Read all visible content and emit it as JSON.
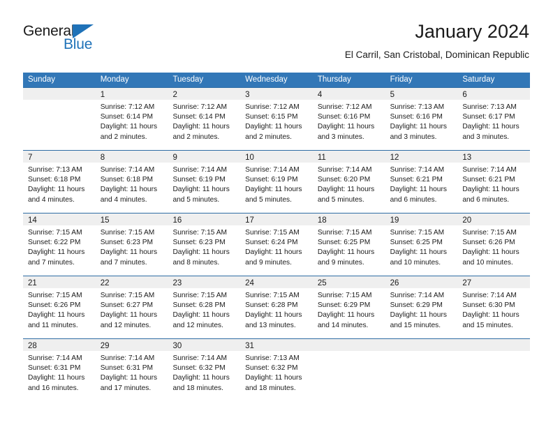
{
  "logo": {
    "word_top": "General",
    "word_bottom": "Blue",
    "triangle_icon": "triangle-icon",
    "color_blue": "#1f72b8",
    "color_black": "#1a1a1a"
  },
  "header": {
    "title": "January 2024",
    "subtitle": "El Carril, San Cristobal, Dominican Republic"
  },
  "theme": {
    "header_blue": "#3277b7",
    "row_border_blue": "#2e6da4",
    "daynum_band": "#efefef",
    "text": "#1a1a1a"
  },
  "calendar": {
    "weekdays": [
      "Sunday",
      "Monday",
      "Tuesday",
      "Wednesday",
      "Thursday",
      "Friday",
      "Saturday"
    ],
    "weeks": [
      [
        {
          "day": "",
          "lines": []
        },
        {
          "day": "1",
          "lines": [
            "Sunrise: 7:12 AM",
            "Sunset: 6:14 PM",
            "Daylight: 11 hours",
            "and 2 minutes."
          ]
        },
        {
          "day": "2",
          "lines": [
            "Sunrise: 7:12 AM",
            "Sunset: 6:14 PM",
            "Daylight: 11 hours",
            "and 2 minutes."
          ]
        },
        {
          "day": "3",
          "lines": [
            "Sunrise: 7:12 AM",
            "Sunset: 6:15 PM",
            "Daylight: 11 hours",
            "and 2 minutes."
          ]
        },
        {
          "day": "4",
          "lines": [
            "Sunrise: 7:12 AM",
            "Sunset: 6:16 PM",
            "Daylight: 11 hours",
            "and 3 minutes."
          ]
        },
        {
          "day": "5",
          "lines": [
            "Sunrise: 7:13 AM",
            "Sunset: 6:16 PM",
            "Daylight: 11 hours",
            "and 3 minutes."
          ]
        },
        {
          "day": "6",
          "lines": [
            "Sunrise: 7:13 AM",
            "Sunset: 6:17 PM",
            "Daylight: 11 hours",
            "and 3 minutes."
          ]
        }
      ],
      [
        {
          "day": "7",
          "lines": [
            "Sunrise: 7:13 AM",
            "Sunset: 6:18 PM",
            "Daylight: 11 hours",
            "and 4 minutes."
          ]
        },
        {
          "day": "8",
          "lines": [
            "Sunrise: 7:14 AM",
            "Sunset: 6:18 PM",
            "Daylight: 11 hours",
            "and 4 minutes."
          ]
        },
        {
          "day": "9",
          "lines": [
            "Sunrise: 7:14 AM",
            "Sunset: 6:19 PM",
            "Daylight: 11 hours",
            "and 5 minutes."
          ]
        },
        {
          "day": "10",
          "lines": [
            "Sunrise: 7:14 AM",
            "Sunset: 6:19 PM",
            "Daylight: 11 hours",
            "and 5 minutes."
          ]
        },
        {
          "day": "11",
          "lines": [
            "Sunrise: 7:14 AM",
            "Sunset: 6:20 PM",
            "Daylight: 11 hours",
            "and 5 minutes."
          ]
        },
        {
          "day": "12",
          "lines": [
            "Sunrise: 7:14 AM",
            "Sunset: 6:21 PM",
            "Daylight: 11 hours",
            "and 6 minutes."
          ]
        },
        {
          "day": "13",
          "lines": [
            "Sunrise: 7:14 AM",
            "Sunset: 6:21 PM",
            "Daylight: 11 hours",
            "and 6 minutes."
          ]
        }
      ],
      [
        {
          "day": "14",
          "lines": [
            "Sunrise: 7:15 AM",
            "Sunset: 6:22 PM",
            "Daylight: 11 hours",
            "and 7 minutes."
          ]
        },
        {
          "day": "15",
          "lines": [
            "Sunrise: 7:15 AM",
            "Sunset: 6:23 PM",
            "Daylight: 11 hours",
            "and 7 minutes."
          ]
        },
        {
          "day": "16",
          "lines": [
            "Sunrise: 7:15 AM",
            "Sunset: 6:23 PM",
            "Daylight: 11 hours",
            "and 8 minutes."
          ]
        },
        {
          "day": "17",
          "lines": [
            "Sunrise: 7:15 AM",
            "Sunset: 6:24 PM",
            "Daylight: 11 hours",
            "and 9 minutes."
          ]
        },
        {
          "day": "18",
          "lines": [
            "Sunrise: 7:15 AM",
            "Sunset: 6:25 PM",
            "Daylight: 11 hours",
            "and 9 minutes."
          ]
        },
        {
          "day": "19",
          "lines": [
            "Sunrise: 7:15 AM",
            "Sunset: 6:25 PM",
            "Daylight: 11 hours",
            "and 10 minutes."
          ]
        },
        {
          "day": "20",
          "lines": [
            "Sunrise: 7:15 AM",
            "Sunset: 6:26 PM",
            "Daylight: 11 hours",
            "and 10 minutes."
          ]
        }
      ],
      [
        {
          "day": "21",
          "lines": [
            "Sunrise: 7:15 AM",
            "Sunset: 6:26 PM",
            "Daylight: 11 hours",
            "and 11 minutes."
          ]
        },
        {
          "day": "22",
          "lines": [
            "Sunrise: 7:15 AM",
            "Sunset: 6:27 PM",
            "Daylight: 11 hours",
            "and 12 minutes."
          ]
        },
        {
          "day": "23",
          "lines": [
            "Sunrise: 7:15 AM",
            "Sunset: 6:28 PM",
            "Daylight: 11 hours",
            "and 12 minutes."
          ]
        },
        {
          "day": "24",
          "lines": [
            "Sunrise: 7:15 AM",
            "Sunset: 6:28 PM",
            "Daylight: 11 hours",
            "and 13 minutes."
          ]
        },
        {
          "day": "25",
          "lines": [
            "Sunrise: 7:15 AM",
            "Sunset: 6:29 PM",
            "Daylight: 11 hours",
            "and 14 minutes."
          ]
        },
        {
          "day": "26",
          "lines": [
            "Sunrise: 7:14 AM",
            "Sunset: 6:29 PM",
            "Daylight: 11 hours",
            "and 15 minutes."
          ]
        },
        {
          "day": "27",
          "lines": [
            "Sunrise: 7:14 AM",
            "Sunset: 6:30 PM",
            "Daylight: 11 hours",
            "and 15 minutes."
          ]
        }
      ],
      [
        {
          "day": "28",
          "lines": [
            "Sunrise: 7:14 AM",
            "Sunset: 6:31 PM",
            "Daylight: 11 hours",
            "and 16 minutes."
          ]
        },
        {
          "day": "29",
          "lines": [
            "Sunrise: 7:14 AM",
            "Sunset: 6:31 PM",
            "Daylight: 11 hours",
            "and 17 minutes."
          ]
        },
        {
          "day": "30",
          "lines": [
            "Sunrise: 7:14 AM",
            "Sunset: 6:32 PM",
            "Daylight: 11 hours",
            "and 18 minutes."
          ]
        },
        {
          "day": "31",
          "lines": [
            "Sunrise: 7:13 AM",
            "Sunset: 6:32 PM",
            "Daylight: 11 hours",
            "and 18 minutes."
          ]
        },
        {
          "day": "",
          "lines": []
        },
        {
          "day": "",
          "lines": []
        },
        {
          "day": "",
          "lines": []
        }
      ]
    ]
  }
}
